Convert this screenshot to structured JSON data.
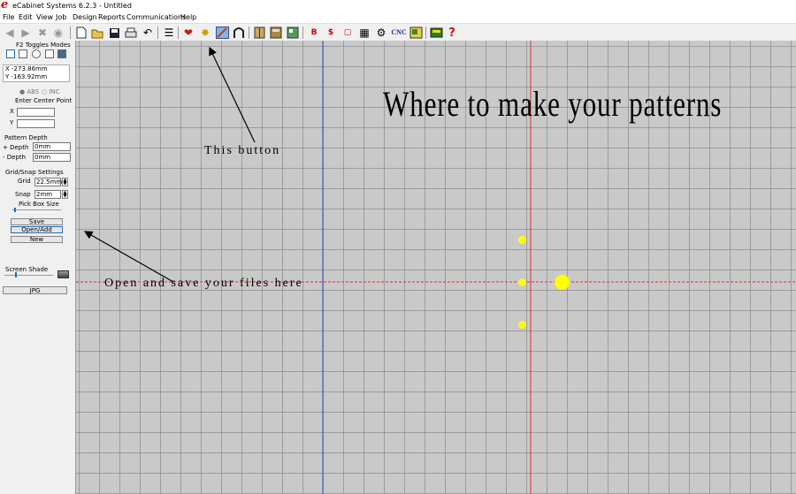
{
  "window": {
    "title": "eCabinet Systems 6.2.3 - Untitled",
    "logo_letter": "e"
  },
  "menu": [
    "File",
    "Edit",
    "View",
    "Job",
    "Design",
    "Reports",
    "Communications",
    "Help"
  ],
  "toolbar": {
    "cnc_label": "CNC",
    "help_glyph": "?"
  },
  "panel": {
    "toggles_title": "F2 Toggles Modes",
    "readout_x": "X -273.86mm",
    "readout_y": "Y -163.92mm",
    "abs_label": "ABS",
    "inc_label": "INC",
    "center_title": "Enter Center Point",
    "center_x_label": "X",
    "center_y_label": "Y",
    "center_x_value": "",
    "center_y_value": "",
    "depth_title": "Pattern Depth",
    "plus_depth_label": "+ Depth",
    "minus_depth_label": "- Depth",
    "plus_depth_value": "0mm",
    "minus_depth_value": "0mm",
    "grid_title": "Grid/Snap Settings",
    "grid_label": "Grid",
    "grid_value": "22.5mm",
    "snap_label": "Snap",
    "snap_value": "2mm",
    "pickbox_label": "Pick Box Size",
    "save_label": "Save",
    "open_label": "Open/Add",
    "new_label": "New",
    "shade_label": "Screen Shade",
    "jpg_label": "JPG"
  },
  "canvas": {
    "heading": "Where to make your patterns",
    "annotation_button": "This button",
    "annotation_files": "Open and save your files here"
  },
  "colors": {
    "canvas": "#c9c9c9",
    "axis_red": "#e03030",
    "axis_blue": "#3050c0",
    "marker": "#ffff00",
    "accent": "#2a6bb0"
  }
}
